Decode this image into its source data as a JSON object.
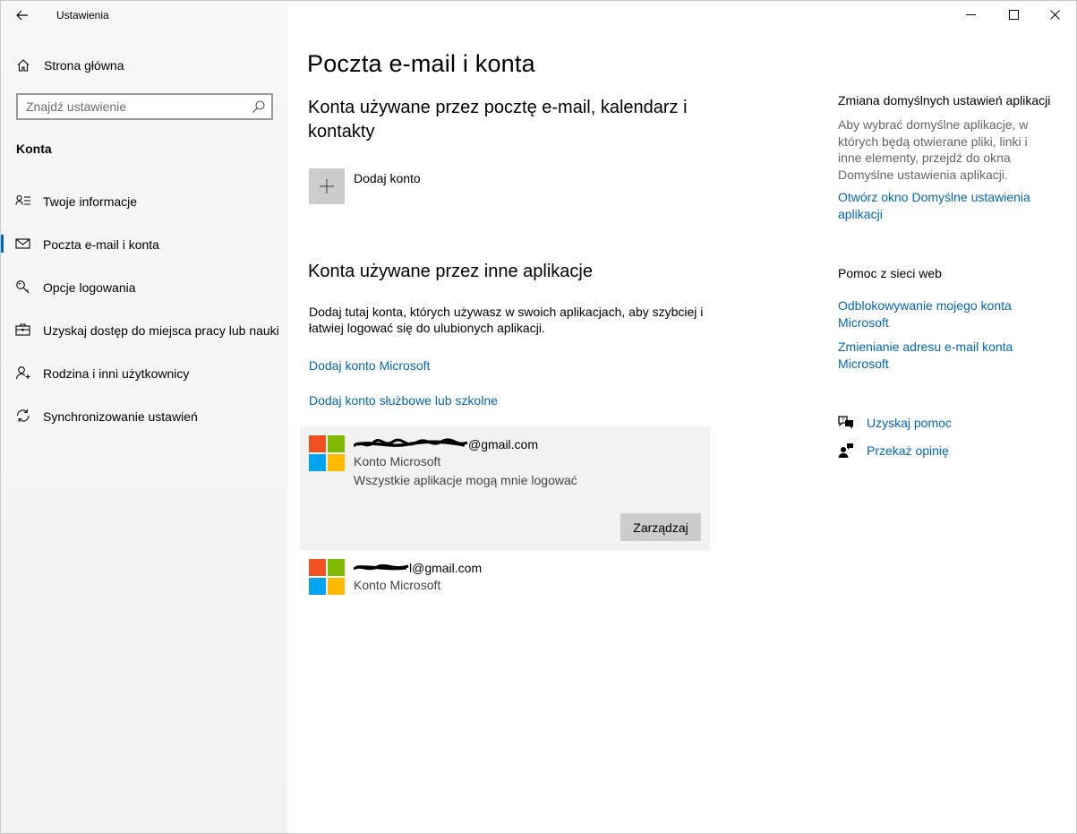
{
  "window": {
    "title": "Ustawienia"
  },
  "sidebar": {
    "home_label": "Strona główna",
    "search_placeholder": "Znajdź ustawienie",
    "section_label": "Konta",
    "items": [
      {
        "label": "Twoje informacje",
        "icon": "person-card-icon",
        "active": false
      },
      {
        "label": "Poczta e-mail i konta",
        "icon": "mail-icon",
        "active": true
      },
      {
        "label": "Opcje logowania",
        "icon": "key-icon",
        "active": false
      },
      {
        "label": "Uzyskaj dostęp do miejsca pracy lub nauki",
        "icon": "briefcase-icon",
        "active": false
      },
      {
        "label": "Rodzina i inni użytkownicy",
        "icon": "add-person-icon",
        "active": false
      },
      {
        "label": "Synchronizowanie ustawień",
        "icon": "sync-icon",
        "active": false
      }
    ]
  },
  "main": {
    "page_title": "Poczta e-mail i konta",
    "section1_title": "Konta używane przez pocztę e-mail, kalendarz i kontakty",
    "add_account_label": "Dodaj konto",
    "section2_title": "Konta używane przez inne aplikacje",
    "section2_desc": "Dodaj tutaj konta, których używasz w swoich aplikacjach, aby szybciej i łatwiej logować się do ulubionych aplikacji.",
    "link_add_microsoft": "Dodaj konto Microsoft",
    "link_add_work": "Dodaj konto służbowe lub szkolne",
    "accounts": [
      {
        "email_suffix": "@gmail.com",
        "type": "Konto Microsoft",
        "note": "Wszystkie aplikacje mogą mnie logować",
        "manage_label": "Zarządzaj"
      },
      {
        "email_suffix": "l@gmail.com",
        "type": "Konto Microsoft"
      }
    ]
  },
  "right": {
    "default_apps_heading": "Zmiana domyślnych ustawień aplikacji",
    "default_apps_text": "Aby wybrać domyślne aplikacje, w których będą otwierane pliki, linki i inne elementy, przejdź do okna Domyślne ustawienia aplikacji.",
    "default_apps_link": "Otwórz okno Domyślne ustawienia aplikacji",
    "web_help_heading": "Pomoc z sieci web",
    "web_links": [
      "Odblokowywanie mojego konta Microsoft",
      "Zmienianie adresu e-mail konta Microsoft"
    ],
    "get_help": "Uzyskaj pomoc",
    "feedback": "Przekaż opinię"
  },
  "colors": {
    "accent": "#0067b8",
    "ms_red": "#f25022",
    "ms_green": "#7fba00",
    "ms_blue": "#00a4ef",
    "ms_yellow": "#ffb900"
  }
}
